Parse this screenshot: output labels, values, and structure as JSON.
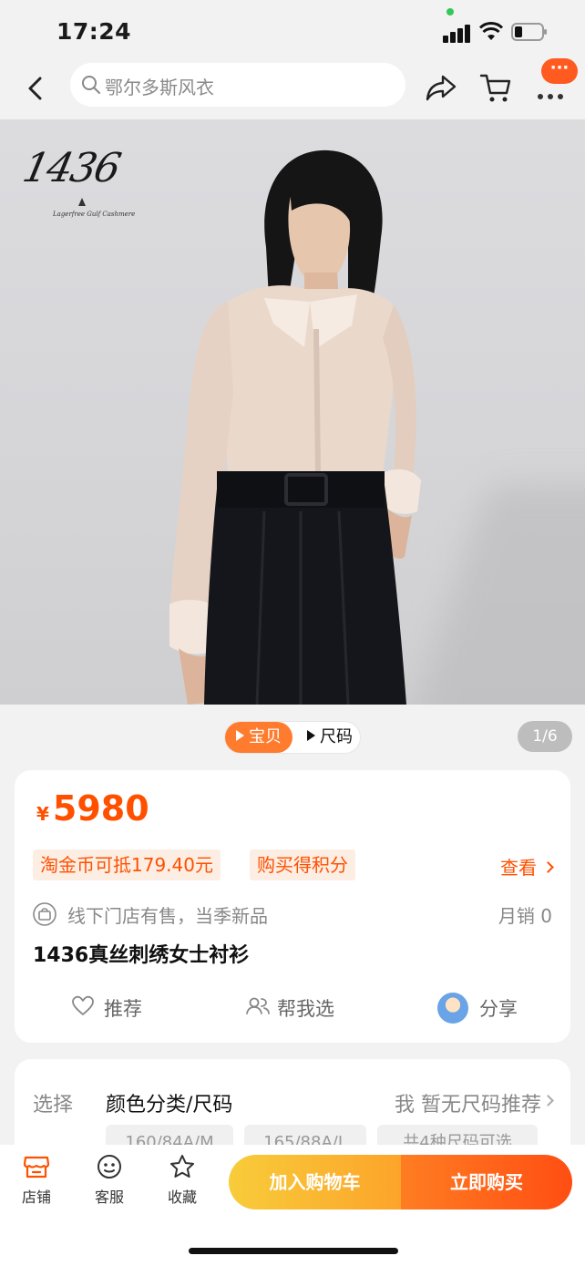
{
  "status_bar": {
    "time": "17:24"
  },
  "nav": {
    "search_placeholder": "鄂尔多斯风衣",
    "more_badge": "···"
  },
  "hero": {
    "brand_logo": "1436",
    "brand_tagline": "Lagerfree Gulf Cashmere"
  },
  "media": {
    "tab_product": "宝贝",
    "tab_size": "尺码",
    "page_counter": "1/6"
  },
  "product": {
    "currency": "¥",
    "price": "5980",
    "coin_tag": "淘金币可抵179.40元",
    "points_tag": "购买得积分",
    "view_label": "查看",
    "store_text": "线下门店有售，当季新品",
    "monthly_sales": "月销 0",
    "title": "1436真丝刺绣女士衬衫",
    "recommend_label": "推荐",
    "help_choose_label": "帮我选",
    "share_label": "分享"
  },
  "options": {
    "label": "选择",
    "value": "颜色分类/尺码",
    "size_hint": "我 暂无尺码推荐",
    "chips": [
      "160/84A/M",
      "165/88A/L",
      "共4种尺码可选"
    ]
  },
  "bottom": {
    "store_label": "店铺",
    "service_label": "客服",
    "favorite_label": "收藏",
    "add_cart_label": "加入购物车",
    "buy_now_label": "立即购买"
  },
  "colors": {
    "accent": "#ff5000",
    "cart_button": "#fcb52f",
    "buy_button": "#ff5a17"
  }
}
